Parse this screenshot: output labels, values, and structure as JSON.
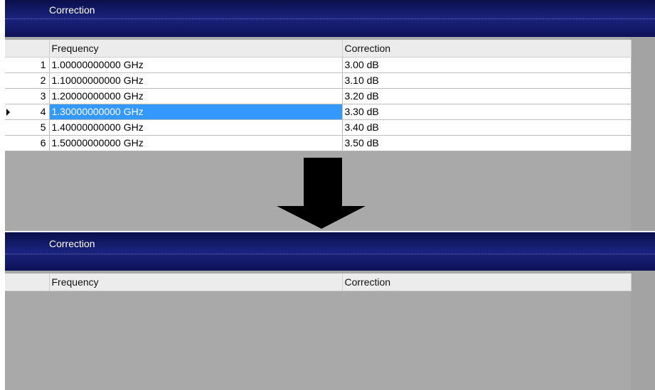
{
  "top_panel": {
    "title": "Correction",
    "columns": [
      "",
      "Frequency",
      "Correction"
    ],
    "rows": [
      {
        "index": "1",
        "frequency": "1.00000000000 GHz",
        "correction": "3.00 dB"
      },
      {
        "index": "2",
        "frequency": "1.10000000000 GHz",
        "correction": "3.10 dB"
      },
      {
        "index": "3",
        "frequency": "1.20000000000 GHz",
        "correction": "3.20 dB"
      },
      {
        "index": "4",
        "frequency": "1.30000000000 GHz",
        "correction": "3.30 dB",
        "selected": true
      },
      {
        "index": "5",
        "frequency": "1.40000000000 GHz",
        "correction": "3.40 dB"
      },
      {
        "index": "6",
        "frequency": "1.50000000000 GHz",
        "correction": "3.50 dB"
      }
    ]
  },
  "bottom_panel": {
    "title": "Correction",
    "columns": [
      "",
      "Frequency",
      "Correction"
    ]
  },
  "colors": {
    "titlebar": "#1a237e",
    "selection": "#3399ff",
    "body": "#a9a9a9"
  },
  "icons": {
    "transition_arrow": "down-arrow-icon",
    "current_row": "row-indicator-icon"
  }
}
